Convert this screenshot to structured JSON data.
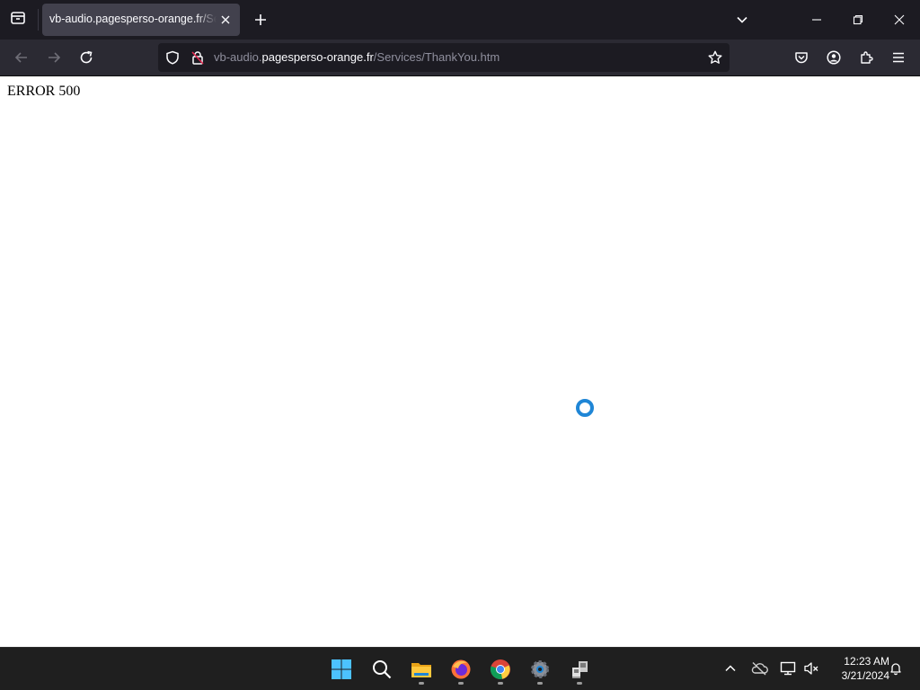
{
  "browser": {
    "tab": {
      "title": "vb-audio.pagesperso-orange.fr/Services/ThankYou.htm"
    },
    "url": {
      "prefix": "vb-audio.",
      "host": "pagesperso-orange.fr",
      "path": "/Services/ThankYou.htm"
    },
    "icons": {
      "tabs_list": "firefox-view-icon",
      "new_tab": "plus-icon",
      "list_all_tabs": "chevron-down-icon",
      "back": "arrow-left-icon",
      "forward": "arrow-right-icon",
      "reload": "reload-icon",
      "tracking": "shield-icon",
      "connection": "lock-warning-icon",
      "bookmark": "star-icon",
      "pocket": "pocket-icon",
      "account": "account-icon",
      "extensions": "puzzle-icon",
      "menu": "hamburger-icon"
    }
  },
  "page": {
    "error_text": "ERROR 500"
  },
  "taskbar": {
    "apps": [
      "start",
      "search",
      "file-explorer",
      "firefox",
      "chrome",
      "settings",
      "network-app"
    ],
    "time": "12:23 AM",
    "date": "3/21/2024"
  },
  "colors": {
    "tabstrip_bg": "#1c1b22",
    "navbar_bg": "#2b2a33",
    "tab_bg": "#42414d",
    "spinner": "#1f86d6",
    "taskbar_bg": "#1f1f1f"
  }
}
